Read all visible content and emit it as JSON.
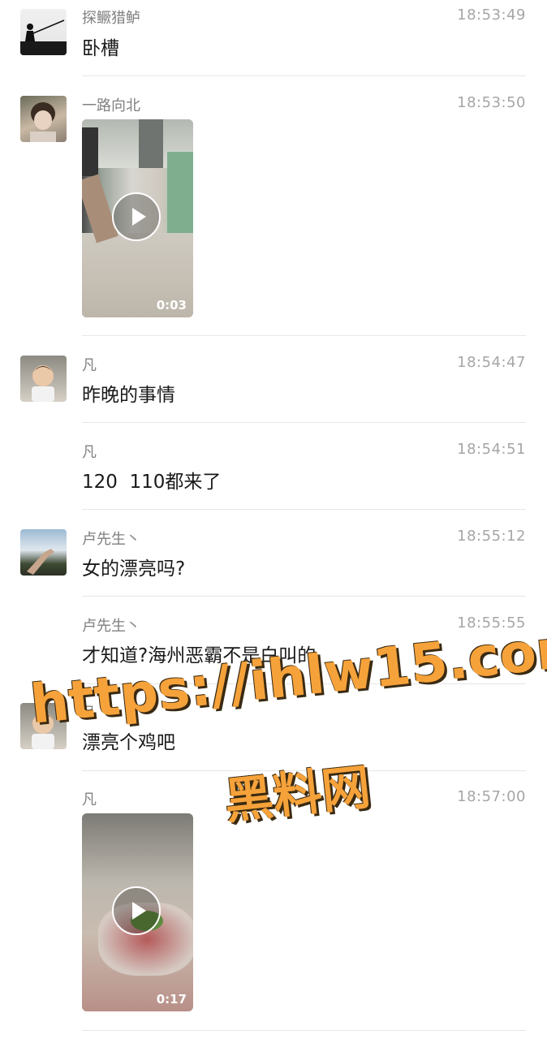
{
  "messages": [
    {
      "name": "探鳜猎鲈",
      "time": "18:53:49",
      "text": "卧槽",
      "avatar": "fisherman-silhouette"
    },
    {
      "name": "一路向北",
      "time": "18:53:50",
      "video_duration": "0:03",
      "avatar": "young-man-portrait"
    },
    {
      "name": "凡",
      "time": "18:54:47",
      "text": "昨晚的事情",
      "avatar": "baby-portrait"
    },
    {
      "name": "凡",
      "time": "18:54:51",
      "text": "120  110都来了"
    },
    {
      "name": "卢先生丶",
      "time": "18:55:12",
      "text": "女的漂亮吗?",
      "avatar": "hand-sky"
    },
    {
      "name": "卢先生丶",
      "time": "18:55:55",
      "text": "才知道?海州恶霸不是白叫的"
    },
    {
      "name": "凡",
      "time": "",
      "text": "漂亮个鸡吧",
      "avatar": "baby-portrait"
    },
    {
      "name": "凡",
      "time": "18:57:00",
      "video_duration": "0:17"
    }
  ],
  "watermark": {
    "line1": "https://ihlw15.com",
    "line2": "黑料网",
    "color": "#f6a23a"
  }
}
